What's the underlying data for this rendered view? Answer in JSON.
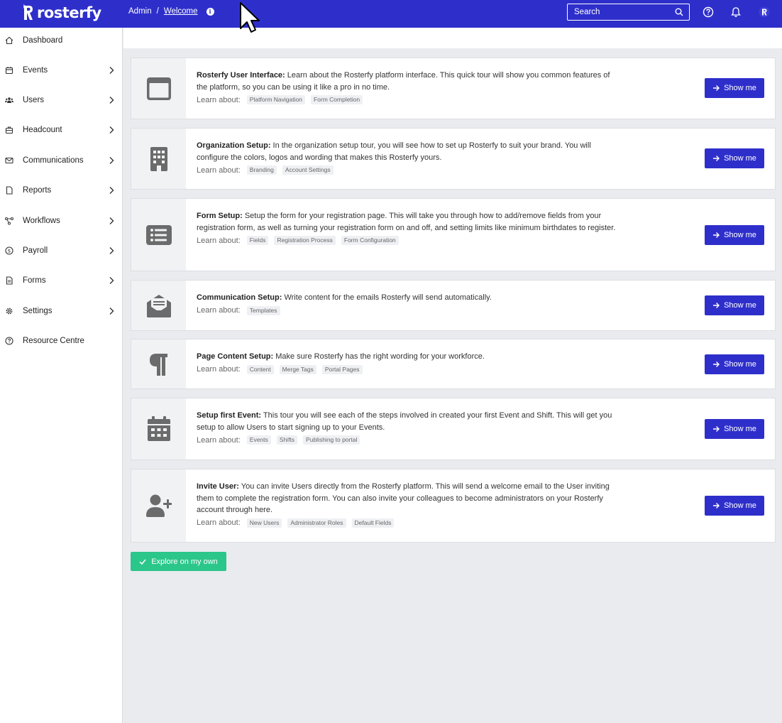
{
  "app": {
    "name": "rosterfy"
  },
  "colors": {
    "primary": "#2e2fcb",
    "success": "#2bc68a",
    "sidebar_bg": "#ffffff",
    "content_bg": "#e9ebef"
  },
  "breadcrumb": {
    "root": "Admin",
    "separator": "/",
    "current": "Welcome"
  },
  "search": {
    "placeholder": "Search"
  },
  "header_icons": [
    "help-icon",
    "bell-icon",
    "user-avatar-icon"
  ],
  "sidebar": {
    "items": [
      {
        "label": "Dashboard",
        "icon": "home-icon",
        "has_children": false
      },
      {
        "label": "Events",
        "icon": "calendar-icon",
        "has_children": true
      },
      {
        "label": "Users",
        "icon": "users-icon",
        "has_children": true
      },
      {
        "label": "Headcount",
        "icon": "briefcase-icon",
        "has_children": true
      },
      {
        "label": "Communications",
        "icon": "mail-icon",
        "has_children": true
      },
      {
        "label": "Reports",
        "icon": "file-icon",
        "has_children": true
      },
      {
        "label": "Workflows",
        "icon": "workflow-icon",
        "has_children": true
      },
      {
        "label": "Payroll",
        "icon": "dollar-icon",
        "has_children": true
      },
      {
        "label": "Forms",
        "icon": "form-icon",
        "has_children": true
      },
      {
        "label": "Settings",
        "icon": "gear-icon",
        "has_children": true
      },
      {
        "label": "Resource Centre",
        "icon": "question-icon",
        "has_children": false
      }
    ]
  },
  "learn_about_label": "Learn about:",
  "show_me_label": "Show me",
  "tours": [
    {
      "title": "Rosterfy User Interface:",
      "text": " Learn about the Rosterfy platform interface. This quick tour will show you common features of the platform, so you can be using it like a pro in no time.",
      "icon": "window-icon",
      "tags": [
        "Platform Navigation",
        "Form Completion"
      ]
    },
    {
      "title": "Organization Setup:",
      "text": " In the organization setup tour, you will see how to set up Rosterfy to suit your brand. You will configure the colors, logos and wording that makes this Rosterfy yours.",
      "icon": "building-icon",
      "tags": [
        "Branding",
        "Account Settings"
      ]
    },
    {
      "title": "Form Setup:",
      "text": " Setup the form for your registration page. This will take you through how to add/remove fields from your registration form, as well as turning your registration form on and off, and setting limits like minimum birthdates to register.",
      "icon": "list-icon",
      "tags": [
        "Fields",
        "Registration Process",
        "Form Configuration"
      ]
    },
    {
      "title": "Communication Setup:",
      "text": " Write content for the emails Rosterfy will send automatically.",
      "icon": "envelope-open-icon",
      "tags": [
        "Templates"
      ]
    },
    {
      "title": "Page Content Setup:",
      "text": " Make sure Rosterfy has the right wording for your workforce.",
      "icon": "paragraph-icon",
      "tags": [
        "Content",
        "Merge Tags",
        "Portal Pages"
      ]
    },
    {
      "title": "Setup first Event:",
      "text": " This tour you will see each of the steps involved in created your first Event and Shift. This will get you setup to allow Users to start signing up to your Events.",
      "icon": "calendar-grid-icon",
      "tags": [
        "Events",
        "Shifts",
        "Publishing to portal"
      ]
    },
    {
      "title": "Invite User:",
      "text": " You can invite Users directly from the Rosterfy platform. This will send a welcome email to the User inviting them to complete the registration form. You can also invite your colleagues to become administrators on your Rosterfy account through here.",
      "icon": "user-plus-icon",
      "tags": [
        "New Users",
        "Administrator Roles",
        "Default Fields"
      ]
    }
  ],
  "explore_label": "Explore on my own"
}
